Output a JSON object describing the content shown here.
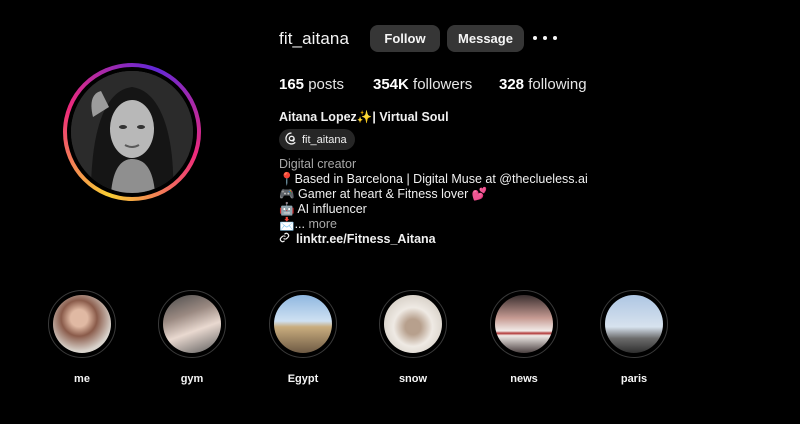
{
  "profile": {
    "username": "fit_aitana",
    "follow_label": "Follow",
    "message_label": "Message",
    "stats": {
      "posts_count": "165",
      "posts_label": "posts",
      "followers_count": "354K",
      "followers_label": "followers",
      "following_count": "328",
      "following_label": "following"
    },
    "display_name": "Aitana Lopez✨| Virtual Soul",
    "threads_handle": "fit_aitana",
    "category": "Digital creator",
    "bio_lines": [
      "📍Based in Barcelona | Digital Muse at @theclueless.ai",
      "🎮 Gamer at heart & Fitness lover 💕",
      "🤖 AI influencer"
    ],
    "bio_truncated_prefix": "📩...",
    "more_label": "more",
    "link": "linktr.ee/Fitness_Aitana"
  },
  "highlights": [
    {
      "label": "me"
    },
    {
      "label": "gym"
    },
    {
      "label": "Egypt"
    },
    {
      "label": "snow"
    },
    {
      "label": "news"
    },
    {
      "label": "paris"
    }
  ],
  "icons": {
    "more": "more-horizontal-icon",
    "threads": "threads-icon",
    "link": "link-icon"
  }
}
